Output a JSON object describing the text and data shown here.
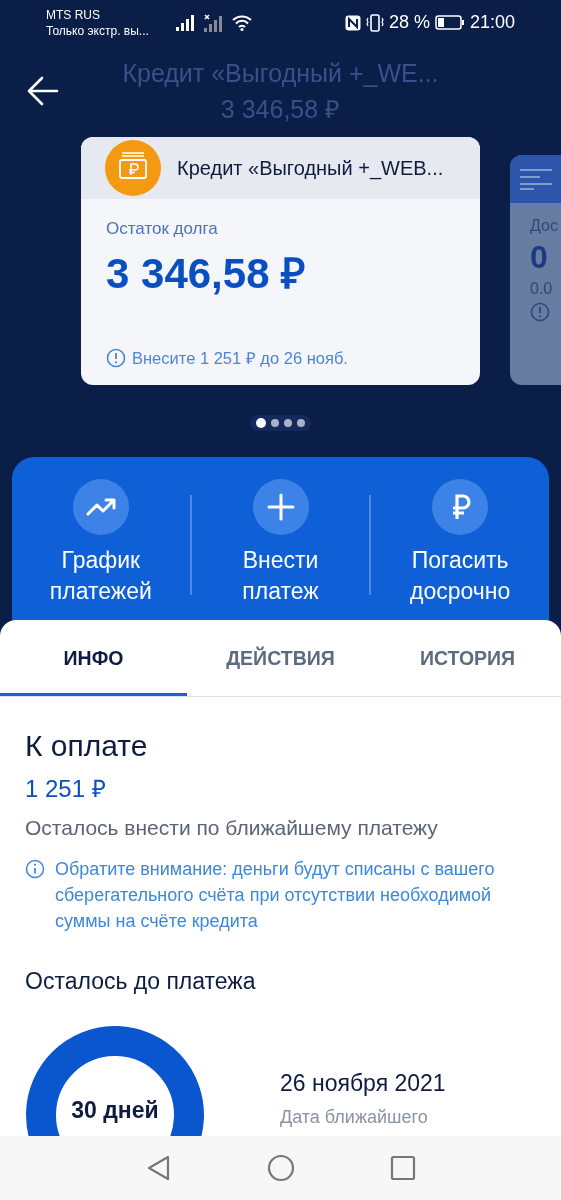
{
  "status_bar": {
    "carrier": "MTS RUS",
    "carrier_note": "Только экстр. вы...",
    "battery_percent": "28 %",
    "time": "21:00"
  },
  "header": {
    "title": "Кредит «Выгодный +_WE...",
    "amount": "3 346,58 ₽"
  },
  "cards": [
    {
      "kind": "loan",
      "title": "Кредит «Выгодный +_WEB...",
      "label": "Остаток долга",
      "amount": "3 346,58 ₽",
      "notice": "Внесите 1 251 ₽ до 26 нояб."
    },
    {
      "kind": "peek",
      "label": "Дос",
      "amount": "0",
      "sub": "0.0"
    }
  ],
  "pager": [
    {
      "selected": true
    },
    {
      "selected": false
    },
    {
      "selected": false
    },
    {
      "selected": false
    }
  ],
  "actions": [
    {
      "kind": "chart",
      "label": "График платежей"
    },
    {
      "kind": "plus",
      "label": "Внести платеж"
    },
    {
      "kind": "ruble",
      "label": "Погасить досрочно"
    }
  ],
  "tabs": [
    {
      "label": "ИНФО",
      "selected": true
    },
    {
      "label": "ДЕЙСТВИЯ",
      "selected": false
    },
    {
      "label": "ИСТОРИЯ",
      "selected": false
    }
  ],
  "payment": {
    "title": "К оплате",
    "amount": "1 251 ₽",
    "caption": "Осталось внести по ближайшему платежу",
    "note": "Обратите внимание: деньги будут списаны с вашего сберегательного счёта при отсутствии необходимой суммы на счёте кредита"
  },
  "countdown": {
    "title": "Осталось до платежа",
    "days": "30 дней",
    "date": "26 ноября 2021",
    "date_label": "Дата ближайшего"
  }
}
